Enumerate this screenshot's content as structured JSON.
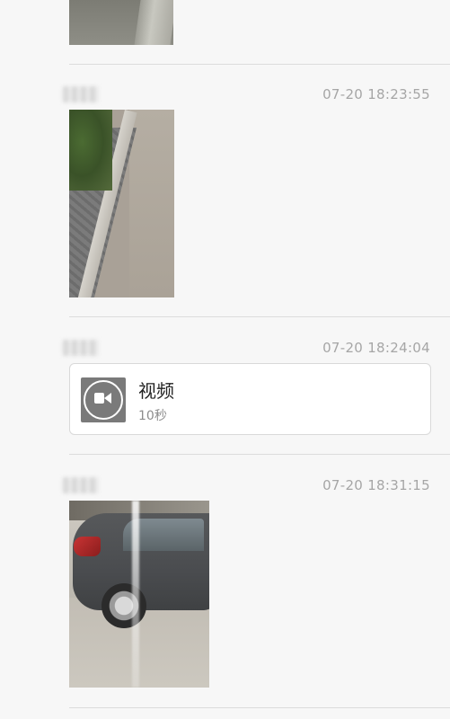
{
  "messages": [
    {
      "type": "image",
      "description": "pavement"
    },
    {
      "type": "image",
      "timestamp": "07-20 18:23:55"
    },
    {
      "type": "video",
      "timestamp": "07-20 18:24:04",
      "title": "视频",
      "duration": "10秒"
    },
    {
      "type": "image",
      "timestamp": "07-20 18:31:15"
    }
  ],
  "icons": {
    "video": "video-camera-icon"
  },
  "colors": {
    "background": "#f7f7f7",
    "timestamp": "#a6a6a6",
    "divider": "#dcdcdc"
  }
}
